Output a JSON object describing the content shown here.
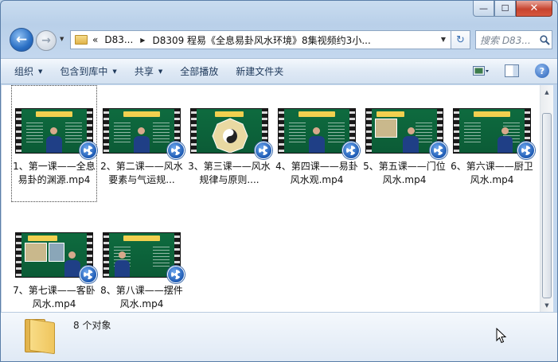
{
  "window": {
    "caption": {
      "minimize": "—",
      "maximize": "☐",
      "close": "✕"
    }
  },
  "address": {
    "overflow": "«",
    "crumbs": [
      "D83...",
      "D8309 程易《全息易卦风水环境》8集视频约3小..."
    ],
    "search_placeholder": "搜索 D83..."
  },
  "toolbar": {
    "organize": "组织",
    "include_library": "包含到库中",
    "share": "共享",
    "play_all": "全部播放",
    "new_folder": "新建文件夹"
  },
  "files": [
    {
      "name": "1、第一课——全息易卦的渊源.mp4",
      "label": "1、第一课——全\n息易卦的渊源.\nmp4",
      "style": "lecture"
    },
    {
      "name": "2、第二课——风水要素与气运规...",
      "label": "2、第二课——风\n水要素与气运规...",
      "style": "lecture"
    },
    {
      "name": "3、第三课——风水规律与原则....",
      "label": "3、第三课——风\n水规律与原则....",
      "style": "diagram"
    },
    {
      "name": "4、第四课——易卦风水观.mp4",
      "label": "4、第四课——易\n卦风水观.mp4",
      "style": "lecture"
    },
    {
      "name": "5、第五课——门位风水.mp4",
      "label": "5、第五课——门\n位风水.mp4",
      "style": "photo"
    },
    {
      "name": "6、第六课——厨卫风水.mp4",
      "label": "6、第六课——厨\n卫风水.mp4",
      "style": "lecture"
    },
    {
      "name": "7、第七课——客卧风水.mp4",
      "label": "7、第七课——客\n卧风水.mp4",
      "style": "photo"
    },
    {
      "name": "8、第八课——摆件风水.mp4",
      "label": "8、第八课——摆\n件风水.mp4",
      "style": "lecture"
    }
  ],
  "status": {
    "count": "8 个对象"
  },
  "colors": {
    "frame_green": "#0e6b3f",
    "title_yellow": "#f2d04f",
    "accent_blue": "#2a6fc4"
  }
}
